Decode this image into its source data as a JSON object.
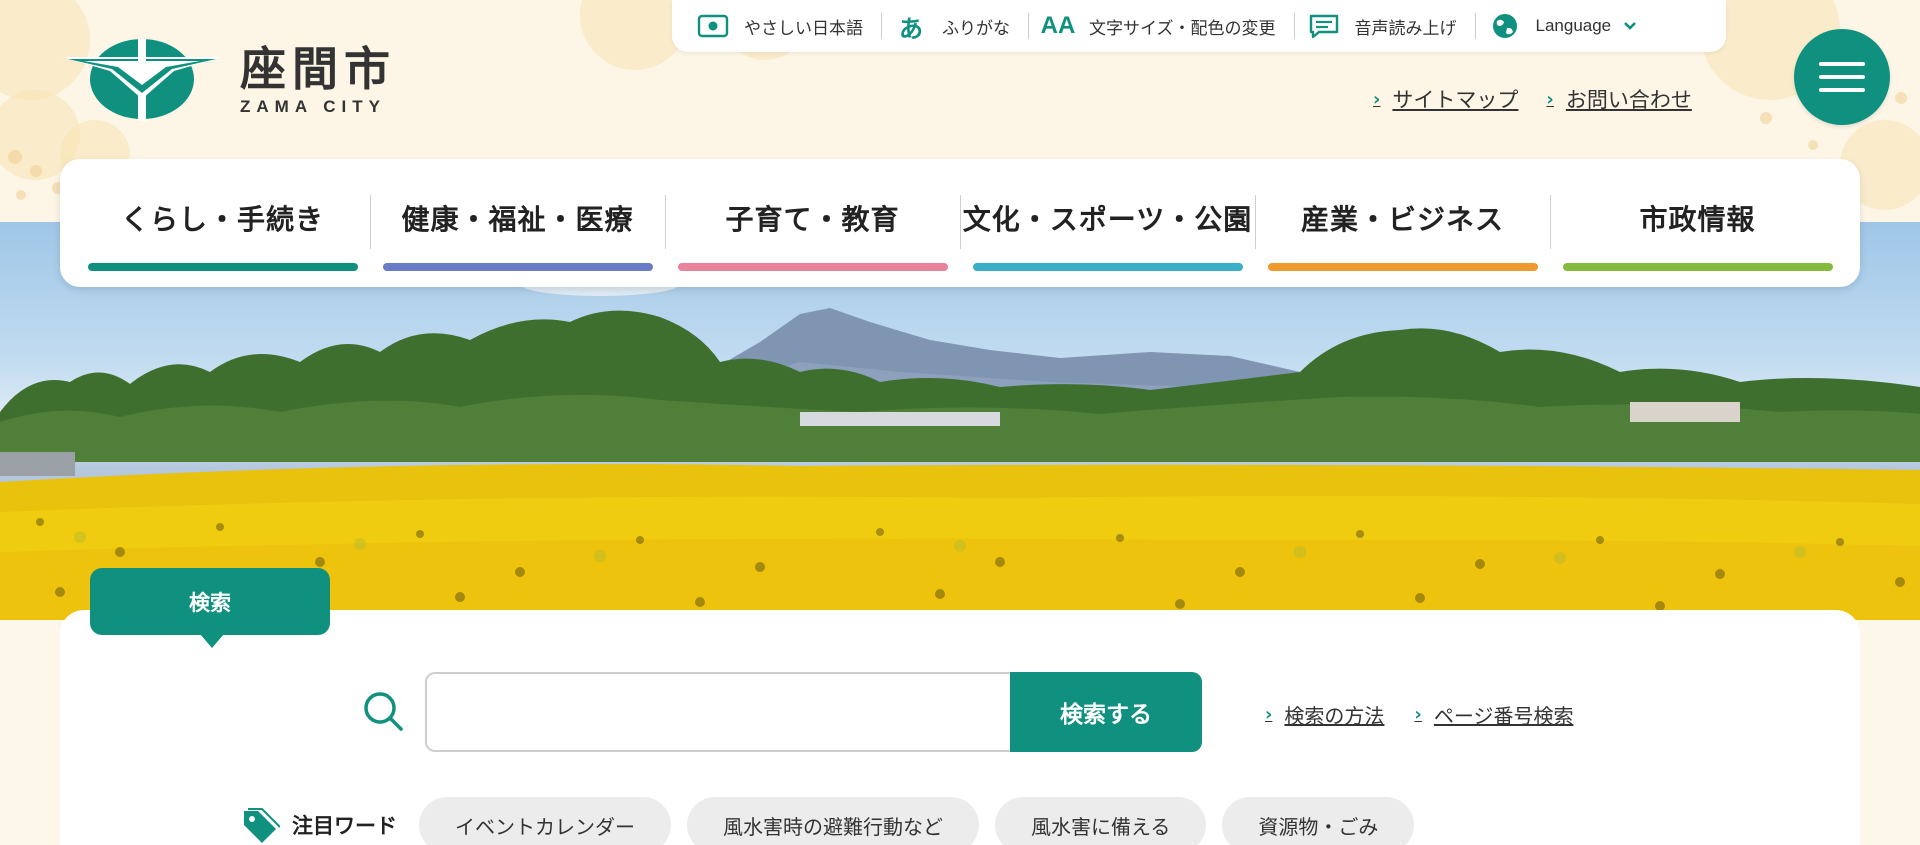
{
  "logo": {
    "name_jp": "座間市",
    "name_en": "ZAMA CITY"
  },
  "toolbar": {
    "items": [
      {
        "label": "やさしい日本語",
        "icon": "easy-japanese-icon"
      },
      {
        "label": "ふりがな",
        "icon": "furigana-icon"
      },
      {
        "label": "文字サイズ・配色の変更",
        "icon": "text-size-icon"
      },
      {
        "label": "音声読み上げ",
        "icon": "speech-icon"
      },
      {
        "label": "Language",
        "icon": "globe-icon"
      }
    ]
  },
  "sublinks": {
    "sitemap": "サイトマップ",
    "contact": "お問い合わせ"
  },
  "nav": {
    "items": [
      {
        "label": "くらし・手続き",
        "color": "#10907f"
      },
      {
        "label": "健康・福祉・医療",
        "color": "#6a7cc6"
      },
      {
        "label": "子育て・教育",
        "color": "#e9829b"
      },
      {
        "label": "文化・スポーツ・公園",
        "color": "#3ab0c8"
      },
      {
        "label": "産業・ビジネス",
        "color": "#ee9a2c"
      },
      {
        "label": "市政情報",
        "color": "#85bb3c"
      }
    ]
  },
  "search": {
    "tab_label": "検索",
    "placeholder": "",
    "button_label": "検索する",
    "links": {
      "how_to": "検索の方法",
      "page_number": "ページ番号検索"
    },
    "keywords_title": "注目ワード",
    "keywords": [
      "イベントカレンダー",
      "風水害時の避難行動など",
      "風水害に備える",
      "資源物・ごみ"
    ]
  },
  "colors": {
    "brand": "#10907f"
  }
}
